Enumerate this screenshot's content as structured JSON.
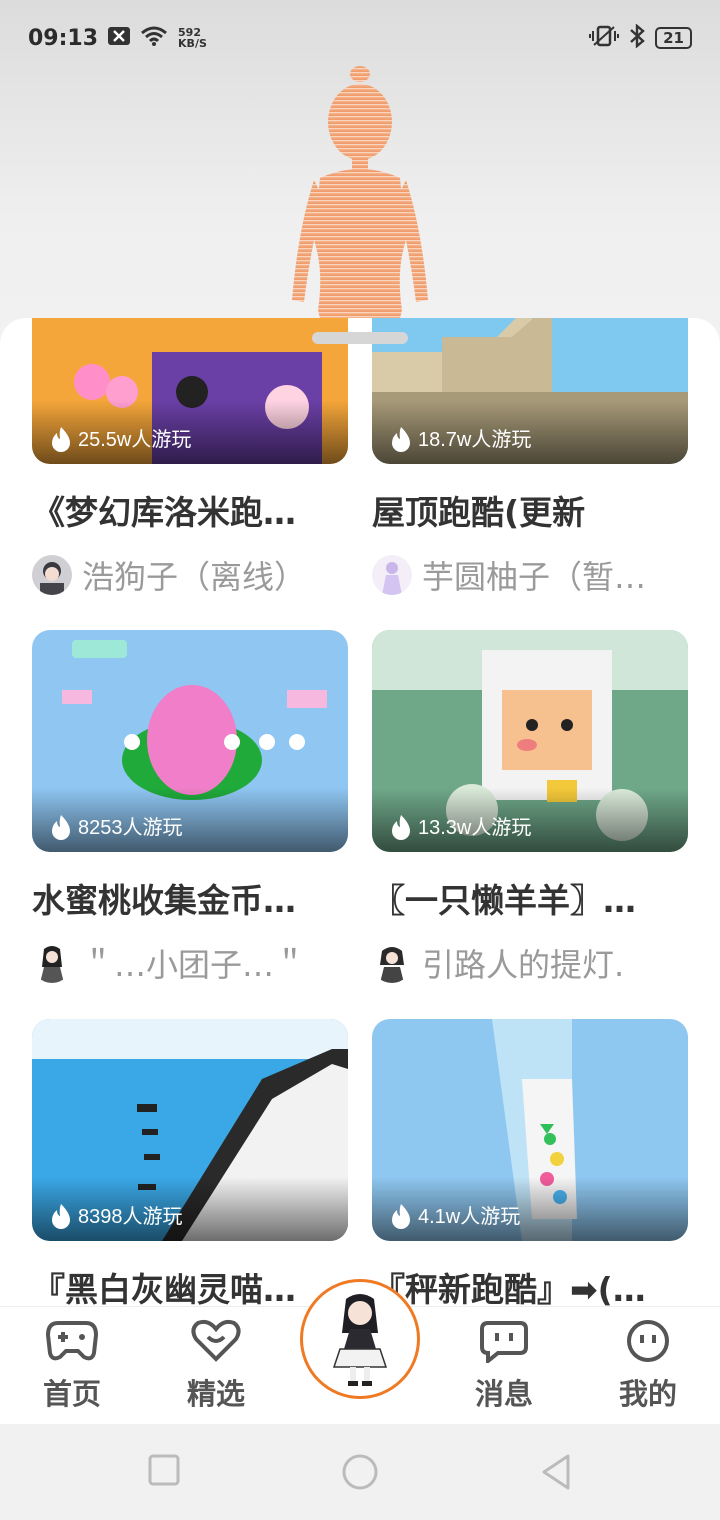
{
  "status_bar": {
    "time": "09:13",
    "net_speed_value": "592",
    "net_speed_unit": "KB/S",
    "battery": "21"
  },
  "feed": {
    "cards": [
      {
        "plays": "25.5w人游玩",
        "title": "《梦幻库洛米跑…",
        "author": "浩狗子（离线）"
      },
      {
        "plays": "18.7w人游玩",
        "title": "屋顶跑酷(更新",
        "author": "芋圆柚子（暂…"
      },
      {
        "plays": "8253人游玩",
        "title": "水蜜桃收集金币…",
        "author": "＂…小团子…＂"
      },
      {
        "plays": "13.3w人游玩",
        "title": "〖一只懒羊羊〗…",
        "author": "引路人的提灯."
      },
      {
        "plays": "8398人游玩",
        "title": "『黑白灰幽灵喵…",
        "author": ""
      },
      {
        "plays": "4.1w人游玩",
        "title": "『秤新跑酷』➡(…",
        "author": ""
      }
    ]
  },
  "tabbar": {
    "home": "首页",
    "featured": "精选",
    "messages": "消息",
    "mine": "我的"
  },
  "colors": {
    "accent": "#f07a23",
    "text_primary": "#333333",
    "text_secondary": "#9a9a9a"
  }
}
